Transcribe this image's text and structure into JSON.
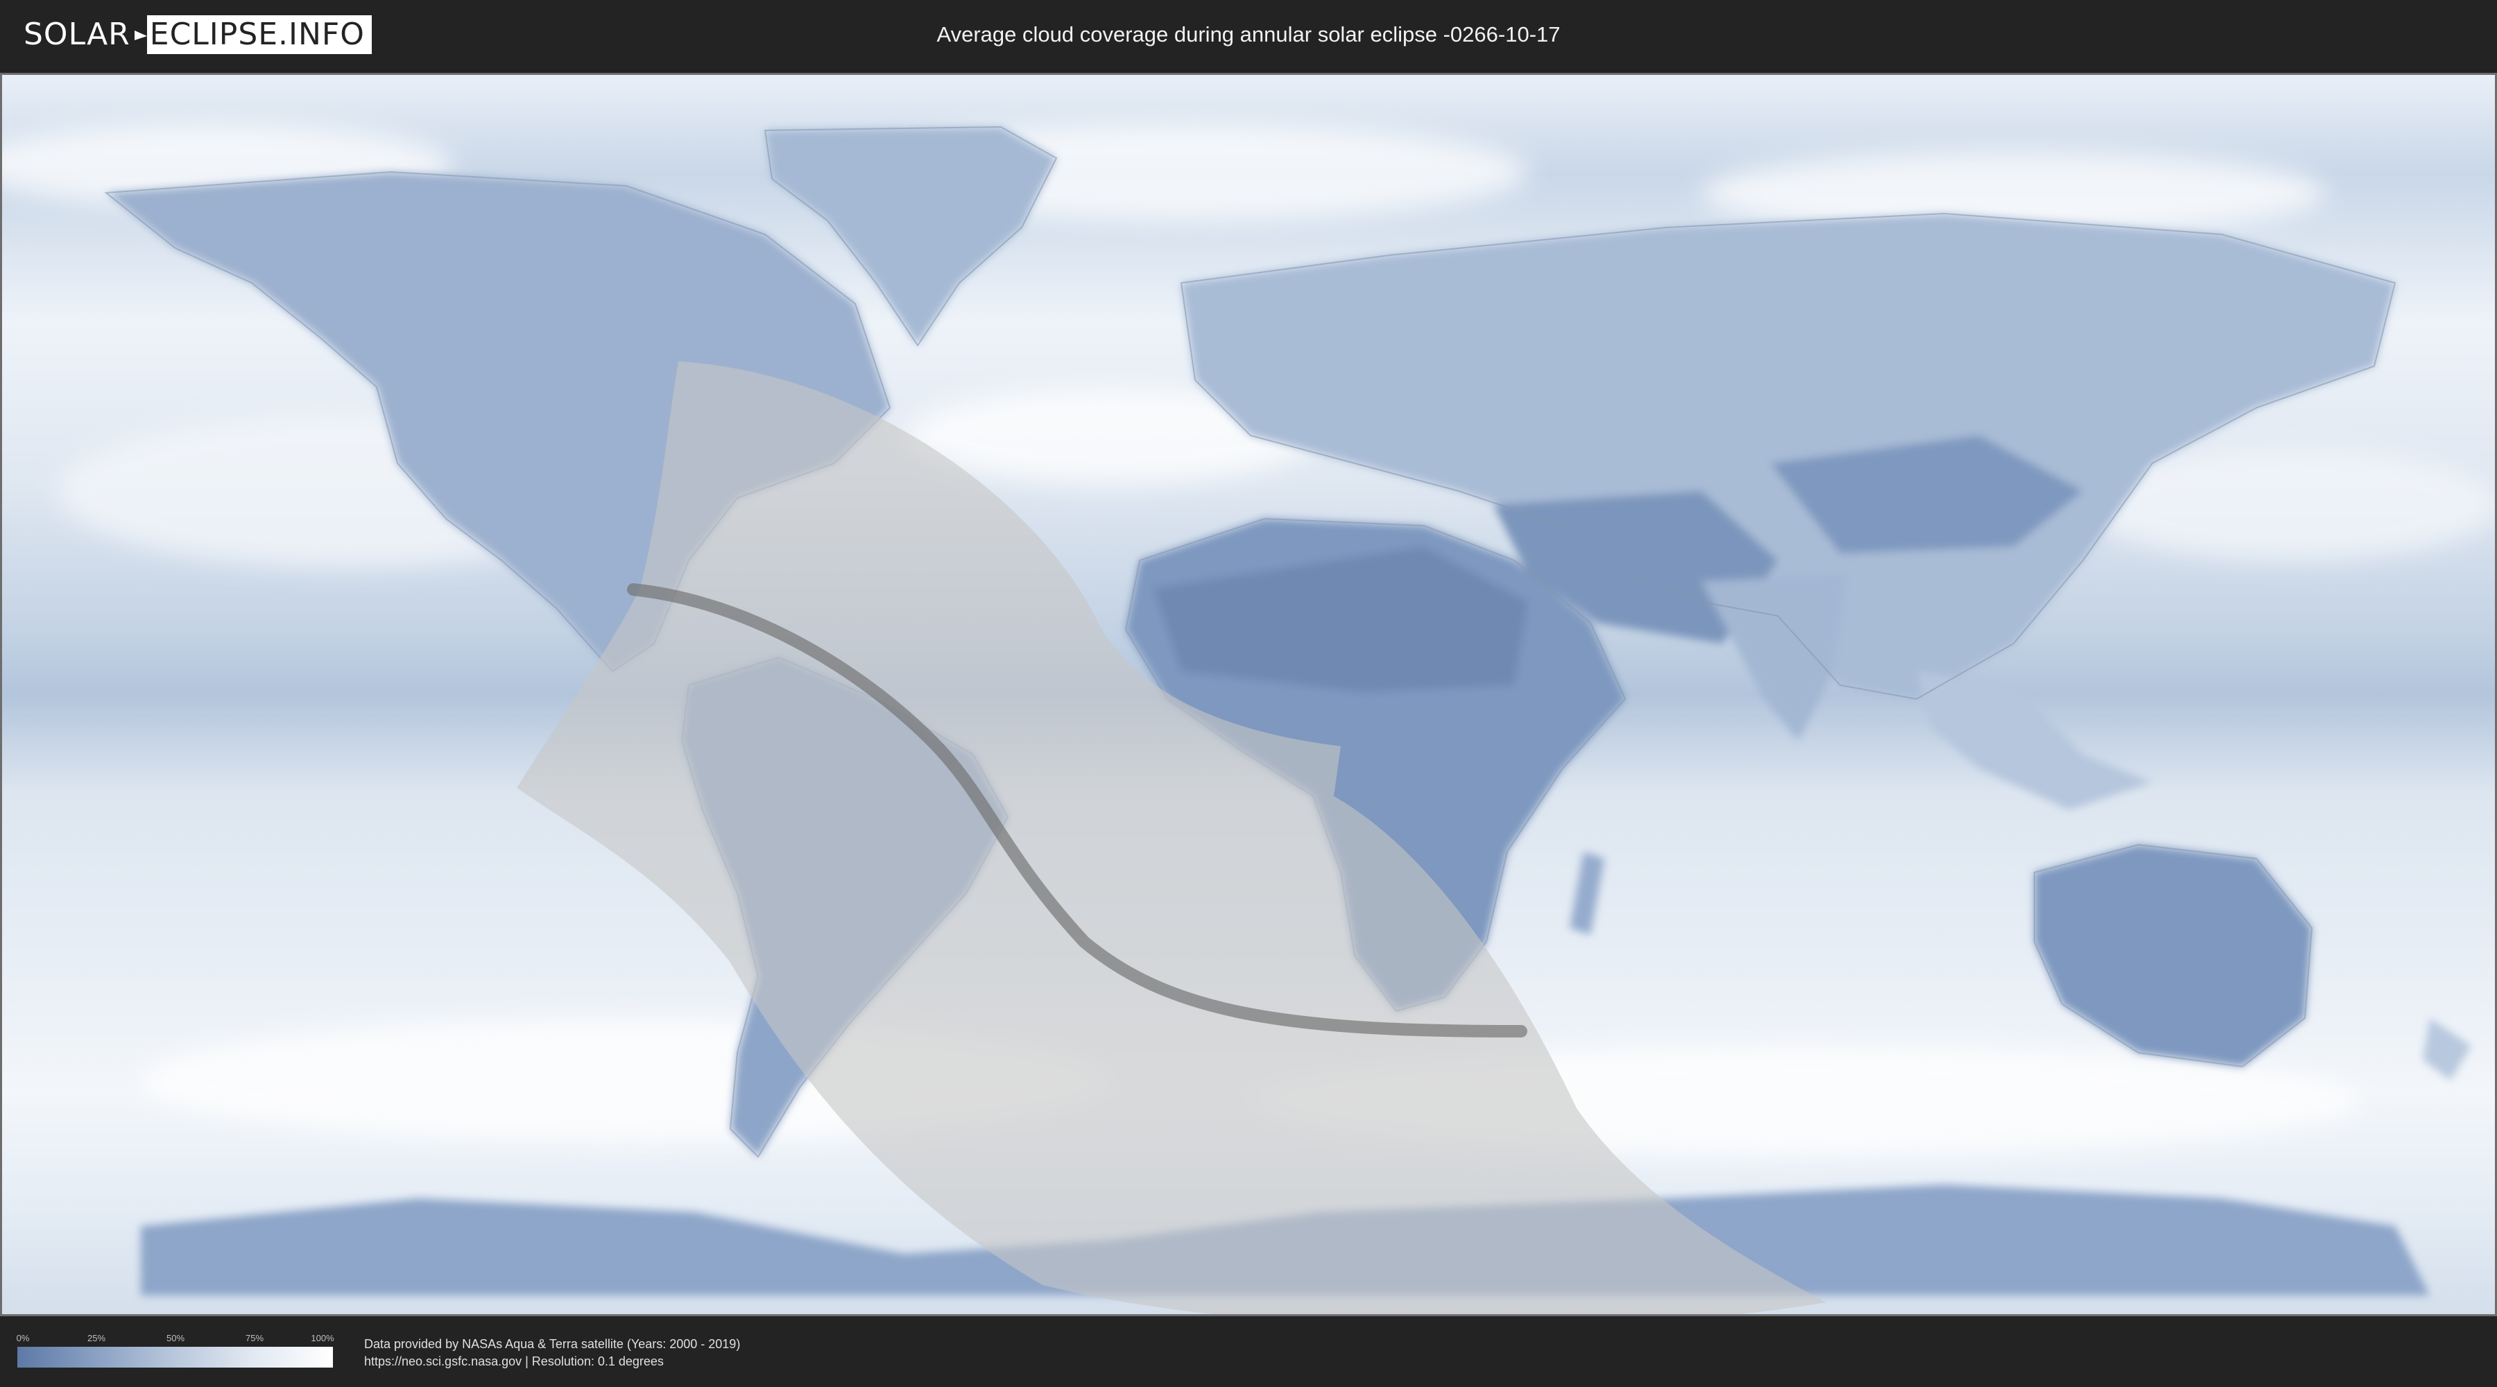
{
  "header": {
    "logo_part1": "SOLAR",
    "logo_part2": "ECLIPSE.INFO",
    "title": "Average cloud coverage during annular solar eclipse -0266-10-17"
  },
  "legend": {
    "ticks": [
      "0%",
      "25%",
      "50%",
      "75%",
      "100%"
    ],
    "gradient_colors": [
      "#5d79a6",
      "#8aa1c3",
      "#b9c8dc",
      "#e2e9f2",
      "#ffffff"
    ]
  },
  "footer": {
    "line1": "Data provided by NASAs Aqua & Terra satellite (Years: 2000 - 2019)",
    "line2": "https://neo.sci.gsfc.nasa.gov | Resolution: 0.1 degrees"
  },
  "map": {
    "colors": {
      "clear_sky": "#6f89b3",
      "cloudy": "#eef3f9",
      "eclipse_zone": "#c6c6c6",
      "central_line": "#6f6f6f"
    }
  }
}
